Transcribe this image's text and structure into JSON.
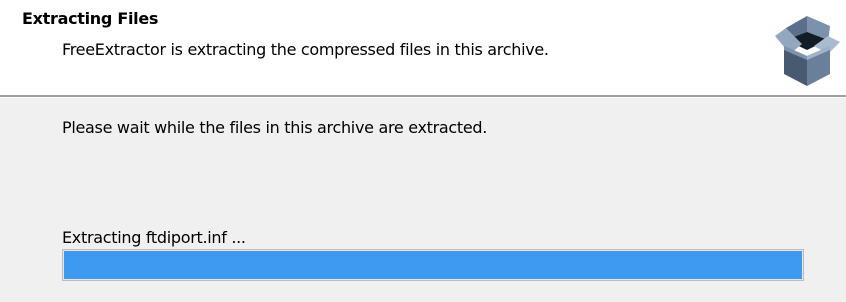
{
  "header": {
    "title": "Extracting Files",
    "subtitle": "FreeExtractor is extracting the compressed files in this archive.",
    "icon": "open-box-icon"
  },
  "main": {
    "message": "Please wait while the files in this archive are extracted.",
    "status": "Extracting ftdiport.inf ...",
    "progress_percent": 100,
    "progress_color": "#3d9aef"
  }
}
